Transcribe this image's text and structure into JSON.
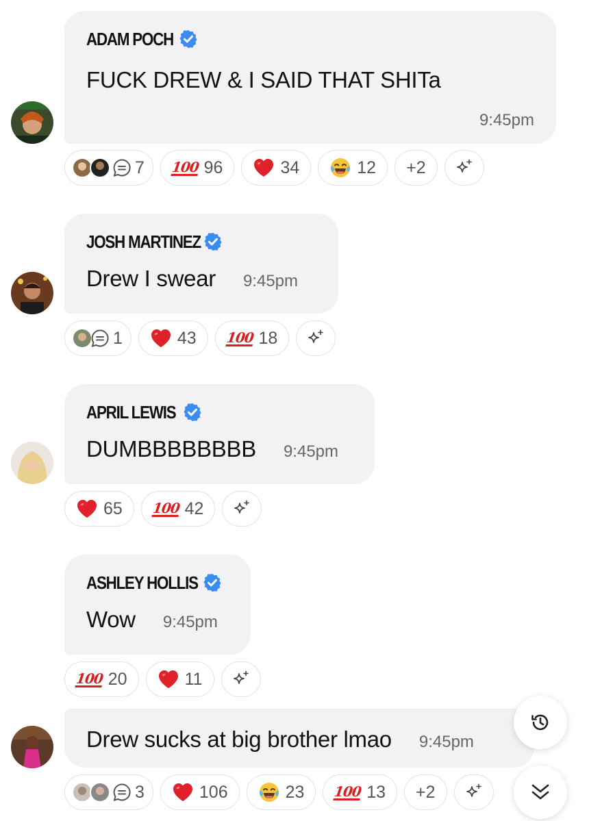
{
  "messages": [
    {
      "author": "ADAM POCH",
      "verified": true,
      "text": "FUCK DREW & I SAID THAT SHITa",
      "time": "9:45pm",
      "thread_count": "7",
      "reactions": [
        {
          "icon": "hundred-points-icon",
          "count": "96"
        },
        {
          "icon": "red-heart-icon",
          "count": "34"
        },
        {
          "icon": "tears-of-joy-icon",
          "count": "12"
        }
      ],
      "more": "+2"
    },
    {
      "author": "JOSH MARTINEZ",
      "verified": true,
      "text": "Drew I swear",
      "time": "9:45pm",
      "thread_count": "1",
      "reactions": [
        {
          "icon": "red-heart-icon",
          "count": "43"
        },
        {
          "icon": "hundred-points-icon",
          "count": "18"
        }
      ]
    },
    {
      "author": "APRIL LEWIS",
      "verified": true,
      "text": "DUMBBBBBBBB",
      "time": "9:45pm",
      "reactions": [
        {
          "icon": "red-heart-icon",
          "count": "65"
        },
        {
          "icon": "hundred-points-icon",
          "count": "42"
        }
      ]
    },
    {
      "author": "ASHLEY HOLLIS",
      "verified": true,
      "text": "Wow",
      "time": "9:45pm",
      "reactions": [
        {
          "icon": "hundred-points-icon",
          "count": "20"
        },
        {
          "icon": "red-heart-icon",
          "count": "11"
        }
      ]
    },
    {
      "author": "",
      "verified": false,
      "text": "Drew sucks at big brother lmao",
      "time": "9:45pm",
      "thread_count": "3",
      "reactions": [
        {
          "icon": "red-heart-icon",
          "count": "106"
        },
        {
          "icon": "tears-of-joy-icon",
          "count": "23"
        },
        {
          "icon": "hundred-points-icon",
          "count": "13"
        }
      ],
      "more": "+2"
    }
  ],
  "icons": {
    "verified": "verified-badge-icon",
    "sparkle": "sparkle-icon",
    "thread": "chat-bubble-icon",
    "history": "history-icon",
    "scroll_down": "double-chevron-down-icon"
  },
  "colors": {
    "bubble": "#f2f2f4",
    "verified_blue": "#3b8cf0",
    "hundred_red": "#d81e1e",
    "heart_red": "#e0202a"
  }
}
